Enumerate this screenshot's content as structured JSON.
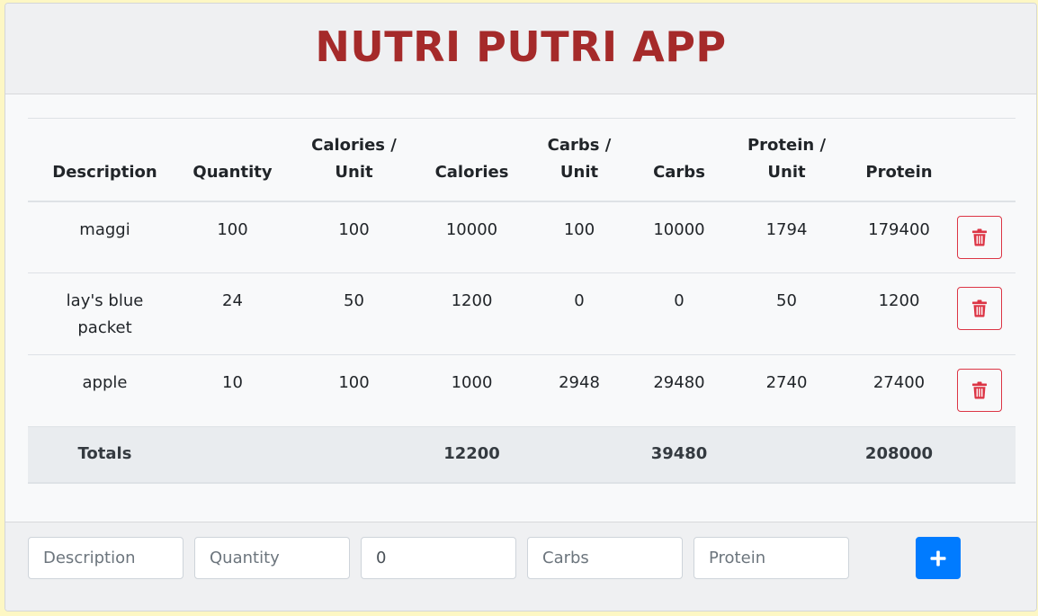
{
  "header": {
    "title": "NUTRI PUTRI APP",
    "title_color": "#a52a2a"
  },
  "table": {
    "columns": [
      "Description",
      "Quantity",
      "Calories /\nUnit",
      "Calories",
      "Carbs /\nUnit",
      "Carbs",
      "Protein /\nUnit",
      "Protein"
    ],
    "column_lines": [
      [
        "Description"
      ],
      [
        "Quantity"
      ],
      [
        "Calories /",
        "Unit"
      ],
      [
        "Calories"
      ],
      [
        "Carbs /",
        "Unit"
      ],
      [
        "Carbs"
      ],
      [
        "Protein /",
        "Unit"
      ],
      [
        "Protein"
      ]
    ],
    "rows": [
      {
        "description": "maggi",
        "quantity": "100",
        "calories_per_unit": "100",
        "calories": "10000",
        "carbs_per_unit": "100",
        "carbs": "10000",
        "protein_per_unit": "1794",
        "protein": "179400"
      },
      {
        "description": "lay's blue packet",
        "description_lines": [
          "lay's blue",
          "packet"
        ],
        "quantity": "24",
        "calories_per_unit": "50",
        "calories": "1200",
        "carbs_per_unit": "0",
        "carbs": "0",
        "protein_per_unit": "50",
        "protein": "1200"
      },
      {
        "description": "apple",
        "quantity": "10",
        "calories_per_unit": "100",
        "calories": "1000",
        "carbs_per_unit": "2948",
        "carbs": "29480",
        "protein_per_unit": "2740",
        "protein": "27400"
      }
    ],
    "totals": {
      "label": "Totals",
      "calories": "12200",
      "carbs": "39480",
      "protein": "208000"
    },
    "delete_icon": "trash-icon",
    "delete_color": "#dc3545"
  },
  "form": {
    "description_placeholder": "Description",
    "quantity_placeholder": "Quantity",
    "calories_value": "0",
    "carbs_placeholder": "Carbs",
    "protein_placeholder": "Protein",
    "add_icon": "plus-icon",
    "add_color": "#007bff"
  }
}
